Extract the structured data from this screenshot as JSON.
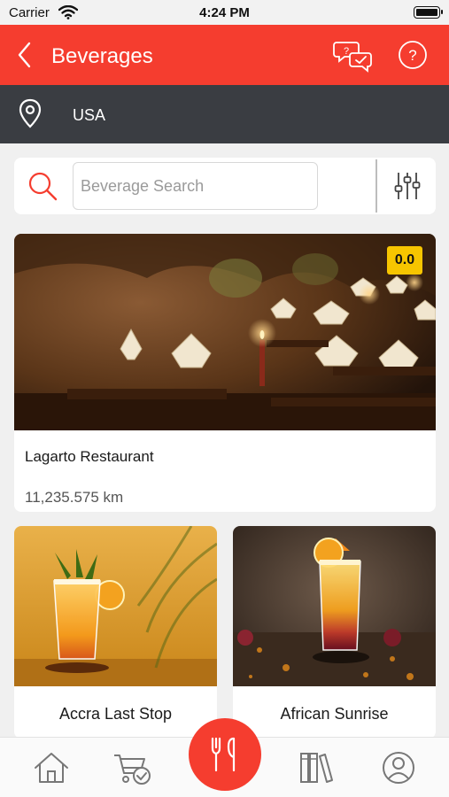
{
  "status_bar": {
    "carrier": "Carrier",
    "time": "4:24 PM"
  },
  "header": {
    "title": "Beverages",
    "back_icon": "chevron-left-icon",
    "chat_icon": "chat-bubbles-icon",
    "help_icon": "question-circle-icon",
    "accent_color": "#f53d2f"
  },
  "location": {
    "value": "USA",
    "icon": "location-pin-icon"
  },
  "search": {
    "placeholder": "Beverage Search",
    "value": "",
    "filter_icon": "sliders-icon"
  },
  "featured": {
    "name": "Lagarto Restaurant",
    "rating": "0.0",
    "distance": "11,235.575 km"
  },
  "items": [
    {
      "name": "Accra Last Stop"
    },
    {
      "name": "African Sunrise"
    }
  ],
  "bottom_nav": {
    "items": [
      "home-icon",
      "cart-check-icon",
      "fork-knife-icon",
      "books-icon",
      "user-circle-icon"
    ],
    "active": "fork-knife-icon"
  }
}
